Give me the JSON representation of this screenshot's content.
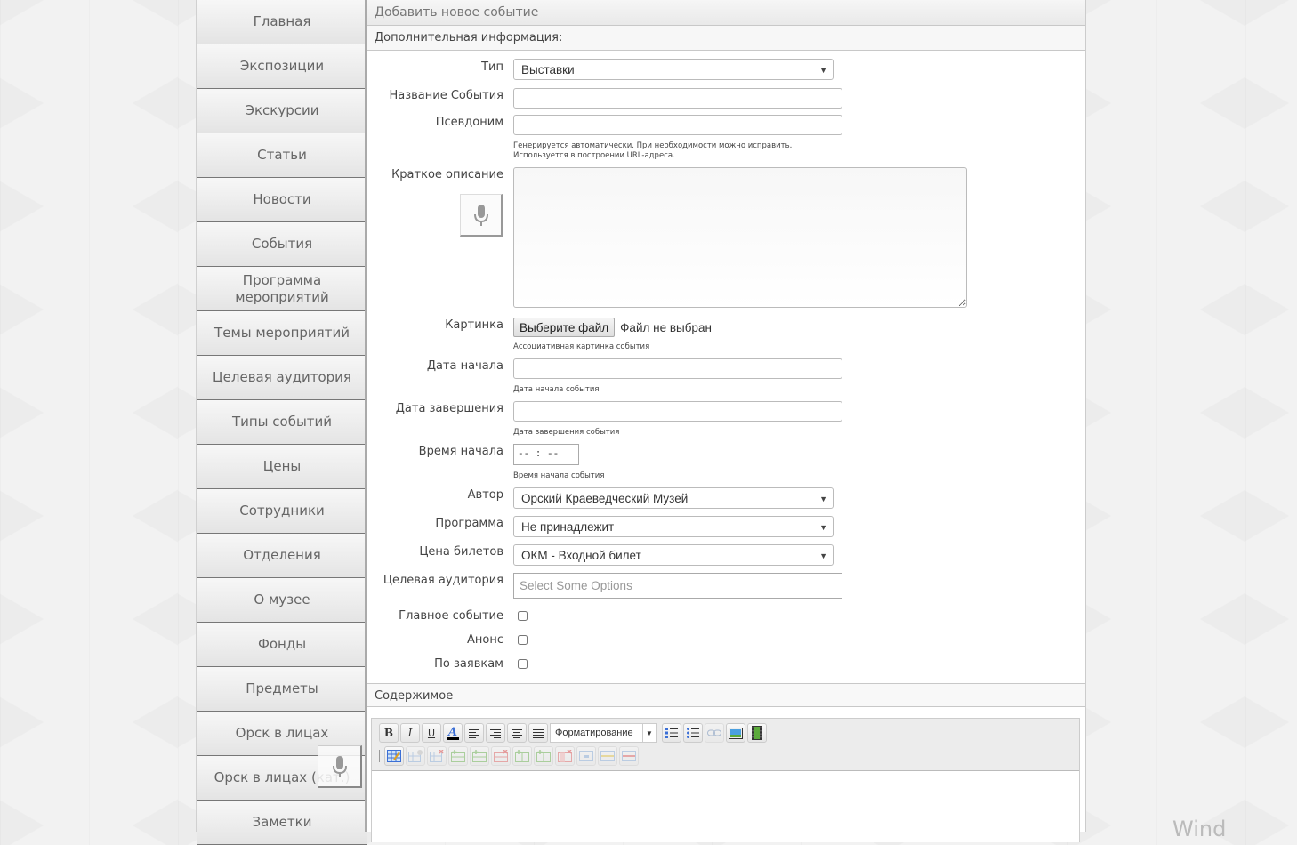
{
  "sidebar": {
    "items": [
      {
        "label": "Главная"
      },
      {
        "label": "Экспозиции"
      },
      {
        "label": "Экскурсии"
      },
      {
        "label": "Статьи"
      },
      {
        "label": "Новости"
      },
      {
        "label": "События"
      },
      {
        "label": "Программа мероприятий"
      },
      {
        "label": "Темы мероприятий"
      },
      {
        "label": "Целевая аудитория"
      },
      {
        "label": "Типы событий"
      },
      {
        "label": "Цены"
      },
      {
        "label": "Сотрудники"
      },
      {
        "label": "Отделения"
      },
      {
        "label": "О музее"
      },
      {
        "label": "Фонды"
      },
      {
        "label": "Предметы"
      },
      {
        "label": "Орск в лицах"
      },
      {
        "label": "Орск в лицах (кат.)"
      },
      {
        "label": "Заметки"
      }
    ]
  },
  "panel": {
    "title": "Добавить новое событие",
    "section": "Дополнительная информация:",
    "fields": {
      "type": {
        "label": "Тип",
        "value": "Выставки"
      },
      "name": {
        "label": "Название События",
        "value": ""
      },
      "alias": {
        "label": "Псевдоним",
        "value": "",
        "hint1": "Генерируется автоматически. При необходимости можно исправить.",
        "hint2": "Используется в построении URL-адреса."
      },
      "short_desc": {
        "label": "Краткое описание",
        "value": ""
      },
      "image": {
        "label": "Картинка",
        "button": "Выберите файл",
        "status": "Файл не выбран",
        "hint": "Ассоциативная картинка события"
      },
      "date_start": {
        "label": "Дата начала",
        "value": "",
        "hint": "Дата начала события"
      },
      "date_end": {
        "label": "Дата завершения",
        "value": "",
        "hint": "Дата завершения события"
      },
      "time_start": {
        "label": "Время начала",
        "value": "-- : --",
        "hint": "Время начала события"
      },
      "author": {
        "label": "Автор",
        "value": "Орский Краеведческий Музей"
      },
      "program": {
        "label": "Программа",
        "value": "Не принадлежит"
      },
      "price": {
        "label": "Цена билетов",
        "value": "ОКМ - Входной билет"
      },
      "audience": {
        "label": "Целевая аудитория",
        "placeholder": "Select Some Options"
      },
      "main_event": {
        "label": "Главное событие",
        "checked": false
      },
      "announce": {
        "label": "Анонс",
        "checked": false
      },
      "by_request": {
        "label": "По заявкам",
        "checked": false
      }
    },
    "content_section": "Содержимое",
    "editor": {
      "format_label": "Форматирование",
      "row1_icons": [
        "bold-icon",
        "italic-icon",
        "underline-icon",
        "text-color-icon",
        "align-left-icon",
        "align-right-icon",
        "align-center-icon",
        "align-justify-icon"
      ],
      "row1_after": [
        "ordered-list-icon",
        "unordered-list-icon",
        "link-icon",
        "image-icon",
        "video-icon"
      ],
      "row2_icons": [
        "table-insert-icon",
        "table-props-icon",
        "table-delete-icon",
        "row-before-icon",
        "row-after-icon",
        "row-delete-icon",
        "col-before-icon",
        "col-after-icon",
        "col-delete-icon",
        "merge-cells-icon",
        "split-cells-icon",
        "delete-cell-icon"
      ]
    }
  },
  "colors": {
    "accent_blue": "#3b6fd6"
  },
  "watermark": "Wind"
}
